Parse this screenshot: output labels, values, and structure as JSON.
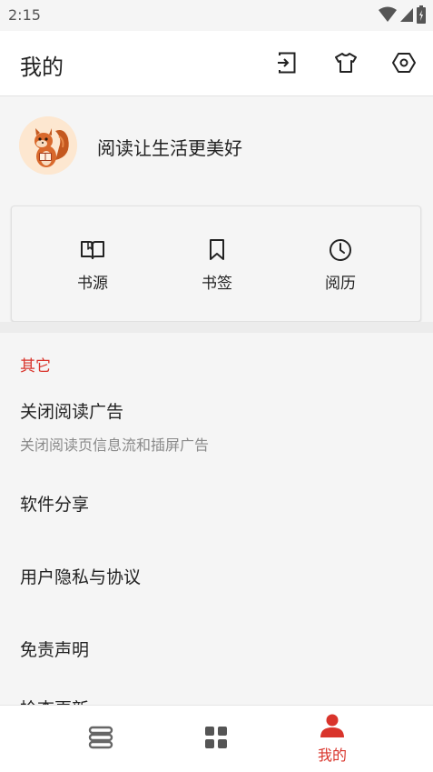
{
  "status_bar": {
    "time": "2:15",
    "icons": [
      "wifi-icon",
      "signal-icon",
      "battery-charging-icon"
    ]
  },
  "app_bar": {
    "title": "我的",
    "actions": [
      "import-icon",
      "theme-shirt-icon",
      "settings-hexagon-icon"
    ]
  },
  "profile": {
    "avatar": "squirrel-avatar",
    "motto": "阅读让生活更美好"
  },
  "quick_actions": [
    {
      "label": "书源",
      "icon": "book-open-icon"
    },
    {
      "label": "书签",
      "icon": "bookmark-icon"
    },
    {
      "label": "阅历",
      "icon": "clock-icon"
    }
  ],
  "section": {
    "title": "其它"
  },
  "menu": [
    {
      "title": "关闭阅读广告",
      "subtitle": "关闭阅读页信息流和插屏广告"
    },
    {
      "title": "软件分享"
    },
    {
      "title": "用户隐私与协议"
    },
    {
      "title": "免责声明"
    },
    {
      "title": "检查更新"
    }
  ],
  "bottom_nav": {
    "items": [
      {
        "icon": "bookshelf-icon",
        "active": false
      },
      {
        "icon": "grid-icon",
        "active": false
      },
      {
        "icon": "person-icon",
        "label": "我的",
        "active": true
      }
    ]
  },
  "colors": {
    "accent": "#d9342b",
    "background": "#f5f5f5",
    "surface": "#ffffff",
    "text": "#222222",
    "subtext": "#8a8a8a"
  }
}
